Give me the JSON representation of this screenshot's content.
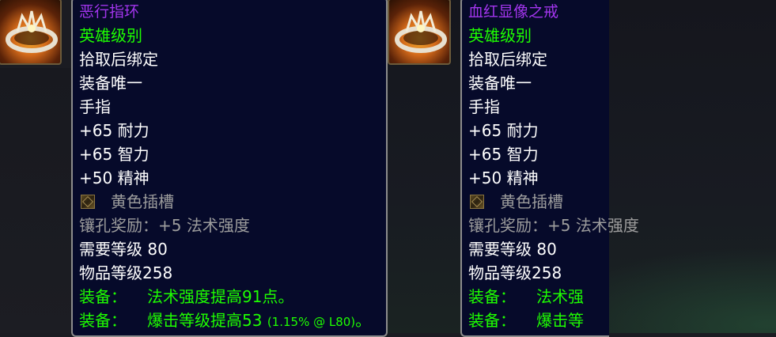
{
  "items": [
    {
      "name": "恶行指环",
      "quality": "英雄级别",
      "binding": "拾取后绑定",
      "unique": "装备唯一",
      "slot": "手指",
      "stats": [
        "+65 耐力",
        "+65 智力",
        "+50 精神"
      ],
      "socket": "黄色插槽",
      "socket_bonus": "镶孔奖励：+5 法术强度",
      "required_level": "需要等级 80",
      "item_level": "物品等级258",
      "equip1_prefix": "装备：",
      "equip1_text": "法术强度提高91点。",
      "equip2_prefix": "装备：",
      "equip2_text": "爆击等级提高53",
      "equip2_small": "(1.15% @ L80)",
      "equip2_end": "。"
    },
    {
      "name": "血红显像之戒",
      "quality": "英雄级别",
      "binding": "拾取后绑定",
      "unique": "装备唯一",
      "slot": "手指",
      "stats": [
        "+65 耐力",
        "+65 智力",
        "+50 精神"
      ],
      "socket": "黄色插槽",
      "socket_bonus": "镶孔奖励：+5 法术强度",
      "required_level": "需要等级 80",
      "item_level": "物品等级258",
      "equip1_prefix": "装备：",
      "equip1_text": "法术强",
      "equip2_prefix": "装备：",
      "equip2_text": "爆击等"
    }
  ],
  "colors": {
    "epic": "#a335ee",
    "green": "#1eff00",
    "white": "#ffffff",
    "gray": "#9d9d9d",
    "tooltip_bg": "#060a2a",
    "border": "#8c8c8c"
  },
  "icons": [
    "ring-item-icon",
    "yellow-socket-icon"
  ]
}
